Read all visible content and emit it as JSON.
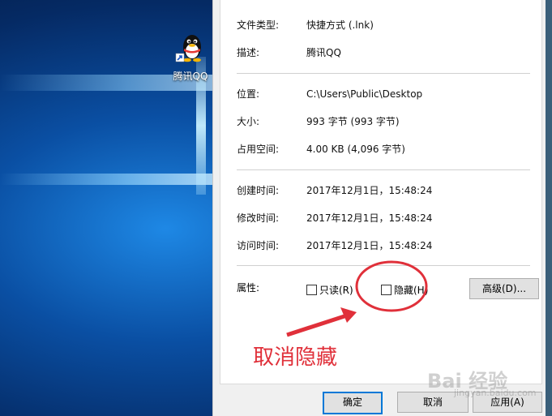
{
  "desktop": {
    "icon_label": "腾讯QQ"
  },
  "properties": [
    {
      "key": "文件类型:",
      "value": "快捷方式 (.lnk)"
    },
    {
      "key": "描述:",
      "value": "腾讯QQ"
    },
    {
      "key": "位置:",
      "value": "C:\\Users\\Public\\Desktop"
    },
    {
      "key": "大小:",
      "value": "993 字节 (993 字节)"
    },
    {
      "key": "占用空间:",
      "value": "4.00 KB (4,096 字节)"
    },
    {
      "key": "创建时间:",
      "value": "2017年12月1日，15:48:24"
    },
    {
      "key": "修改时间:",
      "value": "2017年12月1日，15:48:24"
    },
    {
      "key": "访问时间:",
      "value": "2017年12月1日，15:48:24"
    }
  ],
  "attributes": {
    "label": "属性:",
    "readonly_label": "只读(R)",
    "hidden_label": "隐藏(H)",
    "advanced_label": "高级(D)..."
  },
  "buttons": {
    "ok": "确定",
    "cancel": "取消",
    "apply": "应用(A)"
  },
  "annotation": {
    "text": "取消隐藏",
    "color": "#e0303a"
  },
  "watermark": {
    "text": "Bai 经验",
    "sub": "jingyan.baidu.com"
  }
}
